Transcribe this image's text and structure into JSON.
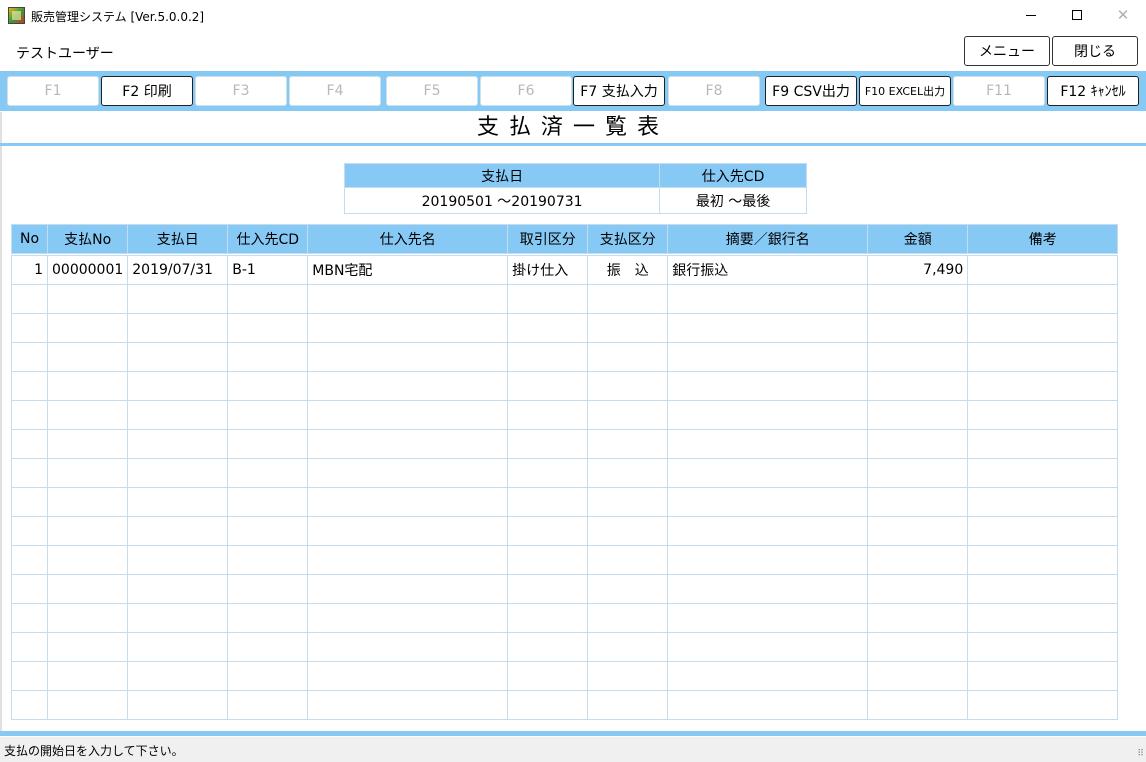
{
  "window": {
    "title": "販売管理システム [Ver.5.0.0.2]",
    "minimize_glyph": "—",
    "close_glyph": "✕"
  },
  "header": {
    "user_name": "テストユーザー",
    "menu_label": "メニュー",
    "close_label": "閉じる"
  },
  "fkeys": [
    {
      "label": "F1",
      "enabled": false
    },
    {
      "label": "F2 印刷",
      "enabled": true
    },
    {
      "label": "F3",
      "enabled": false
    },
    {
      "label": "F4",
      "enabled": false
    },
    {
      "label": "F5",
      "enabled": false
    },
    {
      "label": "F6",
      "enabled": false
    },
    {
      "label": "F7 支払入力",
      "enabled": true
    },
    {
      "label": "F8",
      "enabled": false
    },
    {
      "label": "F9 CSV出力",
      "enabled": true
    },
    {
      "label": "F10 EXCEL出力",
      "enabled": true
    },
    {
      "label": "F11",
      "enabled": false
    },
    {
      "label": "F12 ｷｬﾝｾﾙ",
      "enabled": true
    }
  ],
  "screen_title": "支払済一覧表",
  "conditions": {
    "headers": [
      "支払日",
      "仕入先CD"
    ],
    "values": [
      "20190501 ～20190731",
      "最初 ～最後"
    ]
  },
  "grid": {
    "headers": [
      "No",
      "支払No",
      "支払日",
      "仕入先CD",
      "仕入先名",
      "取引区分",
      "支払区分",
      "摘要／銀行名",
      "金額",
      "備考"
    ],
    "rows": [
      [
        "1",
        "00000001",
        "2019/07/31",
        "B-1",
        "MBN宅配",
        "掛け仕入",
        "振　込",
        "銀行振込",
        "7,490",
        ""
      ]
    ]
  },
  "status": {
    "message": "支払の開始日を入力して下さい。"
  }
}
